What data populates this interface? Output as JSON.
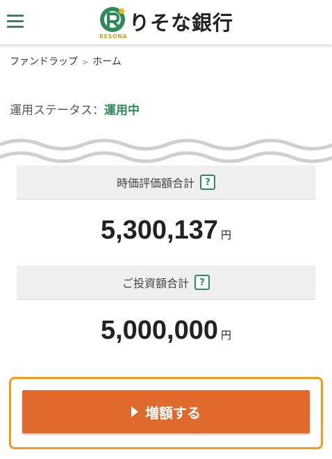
{
  "header": {
    "logo_text": "りそな銀行",
    "logo_sub": "RESONA",
    "menu_icon": "hamburger-menu-icon"
  },
  "breadcrumb": {
    "items": [
      "ファンドラップ",
      "ホーム"
    ],
    "separator": ">"
  },
  "status": {
    "label": "運用ステータス：",
    "value": "運用中"
  },
  "valuation": {
    "label": "時価評価額合計",
    "amount": "5,300,137",
    "unit": "円"
  },
  "investment": {
    "label": "ご投資額合計",
    "amount": "5,000,000",
    "unit": "円"
  },
  "help_label": "?",
  "cta": {
    "label": "増額する"
  },
  "colors": {
    "brand_green": "#2e8b57",
    "cta_orange": "#e06a2c",
    "highlight_frame": "#f39a1e",
    "logo_gold": "#c9a227"
  }
}
